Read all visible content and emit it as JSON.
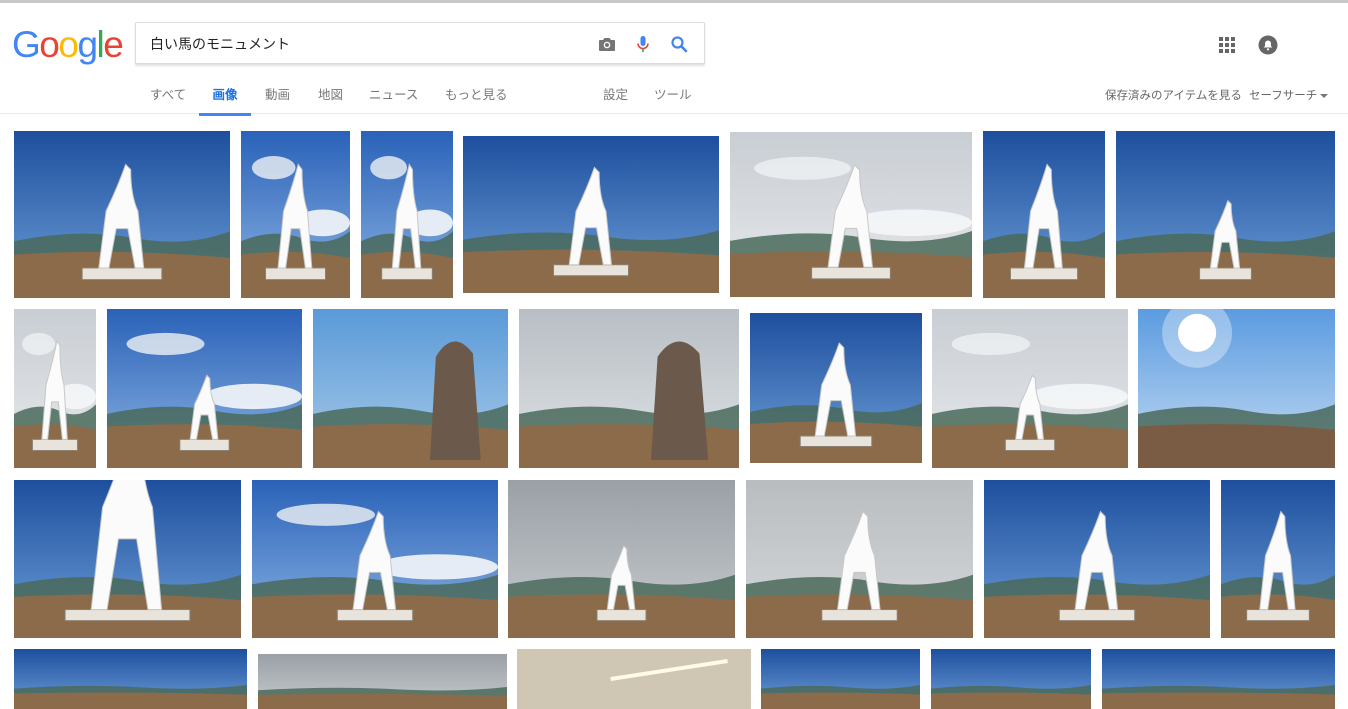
{
  "logo": {
    "text": "Google",
    "letters": [
      "G",
      "o",
      "o",
      "g",
      "l",
      "e"
    ],
    "colors": [
      "#4285f4",
      "#ea4335",
      "#fbbc05",
      "#4285f4",
      "#34a853",
      "#ea4335"
    ]
  },
  "search": {
    "query": "白い馬のモニュメント",
    "icons": [
      "camera-icon",
      "microphone-icon",
      "search-icon"
    ]
  },
  "header_icons": [
    "apps-grid-icon",
    "account-icon"
  ],
  "tabs": [
    {
      "label": "すべて",
      "active": false
    },
    {
      "label": "画像",
      "active": true
    },
    {
      "label": "動画",
      "active": false
    },
    {
      "label": "地図",
      "active": false
    },
    {
      "label": "ニュース",
      "active": false
    },
    {
      "label": "もっと見る",
      "active": false
    }
  ],
  "tools": {
    "settings": "設定",
    "tools": "ツール"
  },
  "right_links": {
    "saved": "保存済みのアイテムを見る",
    "safesearch": "セーフサーチ"
  },
  "colors": {
    "accent": "#4285f4",
    "tab_active": "#1a73e8",
    "sky": "#2a5fb0",
    "ground": "#8b6b4a",
    "statue": "#ffffff"
  },
  "thumbs": [
    {
      "scene": "blue-sky",
      "statue": true,
      "ptrs": "",
      "zoom": "normal"
    },
    {
      "scene": "blue-sky-clouds",
      "statue": true,
      "zoom": "normal"
    },
    {
      "scene": "blue-sky-clouds",
      "statue": true,
      "zoom": "normal"
    },
    {
      "scene": "blue-sky",
      "statue": true,
      "zoom": "normal"
    },
    {
      "scene": "cloudy",
      "statue": true,
      "zoom": "normal"
    },
    {
      "scene": "blue-sky",
      "statue": true,
      "zoom": "normal"
    },
    {
      "scene": "blue-sky",
      "statue": true,
      "zoom": "small"
    },
    {
      "scene": "cloudy",
      "statue": true,
      "zoom": "normal"
    },
    {
      "scene": "blue-sky-clouds",
      "statue": true,
      "zoom": "small"
    },
    {
      "scene": "stone-monument",
      "statue": false,
      "zoom": "normal"
    },
    {
      "scene": "stone-monument-grey",
      "statue": false,
      "zoom": "normal"
    },
    {
      "scene": "blue-sky",
      "statue": true,
      "zoom": "normal"
    },
    {
      "scene": "cloudy",
      "statue": true,
      "zoom": "small"
    },
    {
      "scene": "sun",
      "statue": false,
      "zoom": "normal"
    },
    {
      "scene": "blue-sky",
      "statue": true,
      "zoom": "closeup"
    },
    {
      "scene": "blue-sky-clouds",
      "statue": true,
      "zoom": "normal"
    },
    {
      "scene": "grey",
      "statue": true,
      "zoom": "small"
    },
    {
      "scene": "fog",
      "statue": true,
      "zoom": "normal"
    },
    {
      "scene": "blue-sky",
      "statue": true,
      "zoom": "normal"
    },
    {
      "scene": "blue-sky",
      "statue": true,
      "zoom": "normal"
    },
    {
      "scene": "blue-sky",
      "statue": false,
      "zoom": "normal"
    },
    {
      "scene": "grey",
      "statue": false,
      "zoom": "normal"
    },
    {
      "scene": "indoor",
      "statue": false,
      "zoom": "normal"
    },
    {
      "scene": "blue-sky",
      "statue": false,
      "zoom": "normal"
    },
    {
      "scene": "blue-sky",
      "statue": false,
      "zoom": "normal"
    },
    {
      "scene": "blue-sky",
      "statue": false,
      "zoom": "normal"
    }
  ]
}
